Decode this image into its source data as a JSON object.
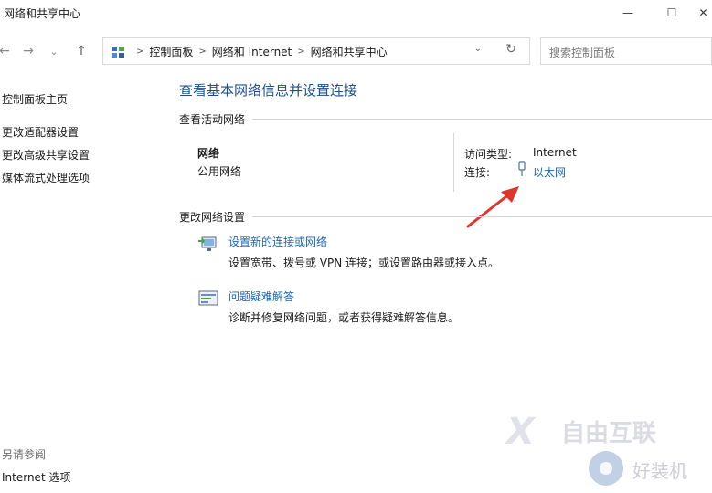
{
  "window": {
    "title": "网络和共享中心",
    "minimize": "—",
    "maximize": "☐",
    "close": "✕"
  },
  "nav": {
    "back": "←",
    "forward": "→",
    "recent": "⌄",
    "up": "↑",
    "breadcrumb": [
      "控制面板",
      "网络和 Internet",
      "网络和共享中心"
    ],
    "dropdown": "⌄",
    "refresh": "↻",
    "search_placeholder": "搜索控制面板"
  },
  "sidebar": {
    "home": "控制面板主页",
    "items": [
      "更改适配器设置",
      "更改高级共享设置",
      "媒体流式处理选项"
    ],
    "see_also_heading": "另请参阅",
    "see_also": [
      "Internet 选项"
    ]
  },
  "main": {
    "title": "查看基本网络信息并设置连接",
    "active_heading": "查看活动网络",
    "network_name": "网络",
    "network_type": "公用网络",
    "access_label": "访问类型:",
    "access_value": "Internet",
    "connection_label": "连接:",
    "connection_value": "以太网",
    "change_heading": "更改网络设置",
    "tasks": [
      {
        "link": "设置新的连接或网络",
        "desc": "设置宽带、拨号或 VPN 连接；或设置路由器或接入点。"
      },
      {
        "link": "问题疑难解答",
        "desc": "诊断并修复网络问题，或者获得疑难解答信息。"
      }
    ]
  },
  "watermark": {
    "logo_text": "自由互联",
    "site_text": "好装机"
  },
  "colors": {
    "link": "#1a66b5",
    "title": "#1e4e8c",
    "arrow": "#e0352b"
  }
}
